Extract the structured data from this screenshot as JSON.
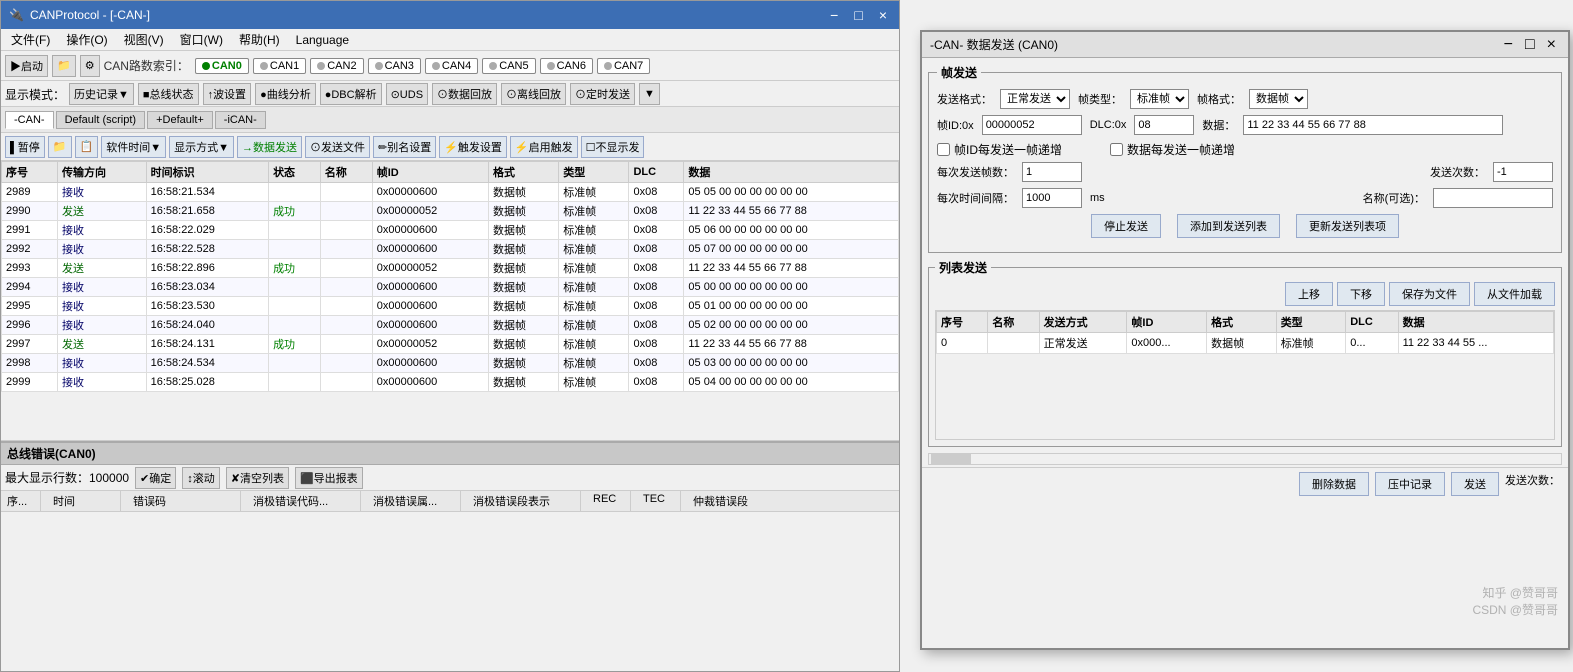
{
  "main_window": {
    "title": "CANProtocol - [-CAN-]",
    "title_btns": [
      "−",
      "□",
      "×"
    ]
  },
  "menu": {
    "items": [
      "文件(F)",
      "操作(O)",
      "视图(V)",
      "窗口(W)",
      "帮助(H)",
      "Language"
    ]
  },
  "toolbar1": {
    "can_path_label": "CAN路数索引：",
    "can_buttons": [
      {
        "label": "●CAN0",
        "active": true
      },
      {
        "label": "●CAN1",
        "active": false
      },
      {
        "label": "●CAN2",
        "active": false
      },
      {
        "label": "●CAN3",
        "active": false
      },
      {
        "label": "●CAN4",
        "active": false
      },
      {
        "label": "●CAN5",
        "active": false
      },
      {
        "label": "●CAN6",
        "active": false
      },
      {
        "label": "●CAN7",
        "active": false
      }
    ]
  },
  "toolbar2": {
    "buttons": [
      "显示模式：",
      "历史记录▼",
      "■总线状态",
      "↑波设置",
      "●曲线分析",
      "●DBC解析",
      "⊙UDS",
      "⊙数据回放",
      "⊙离线回放",
      "⊙定时发送",
      "▼"
    ]
  },
  "tabs": {
    "items": [
      "-CAN-",
      "Default (script)",
      "+Default+",
      "-iCAN-"
    ]
  },
  "toolbar3": {
    "buttons": [
      "▌暂停",
      "📁",
      "📋",
      "软件时间▼",
      "显示方式▼",
      "→数据发送",
      "⊙发送文件",
      "✏别名设置",
      "⚡触发设置",
      "⚡启用触发",
      "☐不显示发"
    ]
  },
  "table": {
    "headers": [
      "序号",
      "传输方向",
      "时间标识",
      "状态",
      "名称",
      "帧ID",
      "格式",
      "类型",
      "DLC",
      "数据"
    ],
    "rows": [
      {
        "id": "2989",
        "dir": "接收",
        "time": "16:58:21.534",
        "status": "",
        "name": "",
        "frame_id": "0x00000600",
        "format": "数据帧",
        "type": "标准帧",
        "dlc": "0x08",
        "data": "05 05 00 00 00 00 00 00"
      },
      {
        "id": "2990",
        "dir": "发送",
        "time": "16:58:21.658",
        "status": "成功",
        "name": "",
        "frame_id": "0x00000052",
        "format": "数据帧",
        "type": "标准帧",
        "dlc": "0x08",
        "data": "11 22 33 44 55 66 77 88"
      },
      {
        "id": "2991",
        "dir": "接收",
        "time": "16:58:22.029",
        "status": "",
        "name": "",
        "frame_id": "0x00000600",
        "format": "数据帧",
        "type": "标准帧",
        "dlc": "0x08",
        "data": "05 06 00 00 00 00 00 00"
      },
      {
        "id": "2992",
        "dir": "接收",
        "time": "16:58:22.528",
        "status": "",
        "name": "",
        "frame_id": "0x00000600",
        "format": "数据帧",
        "type": "标准帧",
        "dlc": "0x08",
        "data": "05 07 00 00 00 00 00 00"
      },
      {
        "id": "2993",
        "dir": "发送",
        "time": "16:58:22.896",
        "status": "成功",
        "name": "",
        "frame_id": "0x00000052",
        "format": "数据帧",
        "type": "标准帧",
        "dlc": "0x08",
        "data": "11 22 33 44 55 66 77 88"
      },
      {
        "id": "2994",
        "dir": "接收",
        "time": "16:58:23.034",
        "status": "",
        "name": "",
        "frame_id": "0x00000600",
        "format": "数据帧",
        "type": "标准帧",
        "dlc": "0x08",
        "data": "05 00 00 00 00 00 00 00"
      },
      {
        "id": "2995",
        "dir": "接收",
        "time": "16:58:23.530",
        "status": "",
        "name": "",
        "frame_id": "0x00000600",
        "format": "数据帧",
        "type": "标准帧",
        "dlc": "0x08",
        "data": "05 01 00 00 00 00 00 00"
      },
      {
        "id": "2996",
        "dir": "接收",
        "time": "16:58:24.040",
        "status": "",
        "name": "",
        "frame_id": "0x00000600",
        "format": "数据帧",
        "type": "标准帧",
        "dlc": "0x08",
        "data": "05 02 00 00 00 00 00 00"
      },
      {
        "id": "2997",
        "dir": "发送",
        "time": "16:58:24.131",
        "status": "成功",
        "name": "",
        "frame_id": "0x00000052",
        "format": "数据帧",
        "type": "标准帧",
        "dlc": "0x08",
        "data": "11 22 33 44 55 66 77 88"
      },
      {
        "id": "2998",
        "dir": "接收",
        "time": "16:58:24.534",
        "status": "",
        "name": "",
        "frame_id": "0x00000600",
        "format": "数据帧",
        "type": "标准帧",
        "dlc": "0x08",
        "data": "05 03 00 00 00 00 00 00"
      },
      {
        "id": "2999",
        "dir": "接收",
        "time": "16:58:25.028",
        "status": "",
        "name": "",
        "frame_id": "0x00000600",
        "format": "数据帧",
        "type": "标准帧",
        "dlc": "0x08",
        "data": "05 04 00 00 00 00 00 00"
      }
    ]
  },
  "error_section": {
    "title": "总线错误(CAN0)",
    "max_rows": "最大显示行数：100000",
    "confirm_btn": "✔确定",
    "scroll_btn": "↕滚动",
    "clear_btn": "✘清空列表",
    "export_btn": "⬛导出报表",
    "headers": [
      "序...",
      "时间",
      "错误码",
      "消极错误代码...",
      "消极错误属...",
      "消极错误段表示",
      "REC",
      "TEC",
      "仲裁错误段"
    ]
  },
  "dialog": {
    "title": "-CAN- 数据发送 (CAN0)",
    "close_btn": "×",
    "min_btn": "−",
    "restore_btn": "□",
    "frame_send_section": "帧发送",
    "send_format_label": "发送格式：",
    "send_format_value": "正常发送",
    "frame_type_label": "帧类型：",
    "frame_type_value": "标准帧",
    "frame_format_label": "帧格式：",
    "frame_format_value": "数据帧",
    "frame_id_label": "帧ID:0x",
    "frame_id_value": "00000052",
    "dlc_label": "DLC:0x",
    "dlc_value": "08",
    "data_label": "数据：",
    "data_value": "11 22 33 44 55 66 77 88",
    "check1": "帧ID每发送一帧递增",
    "check2": "数据每发送一帧递增",
    "send_count_label": "每次发送帧数：",
    "send_count_value": "1",
    "send_total_label": "发送次数：",
    "send_total_value": "-1",
    "interval_label": "每次时间间隔：",
    "interval_value": "1000",
    "interval_unit": "ms",
    "name_label": "名称(可选)：",
    "name_value": "",
    "stop_btn": "停止发送",
    "add_btn": "添加到发送列表",
    "update_btn": "更新发送列表项",
    "list_send_section": "列表发送",
    "up_btn": "上移",
    "down_btn": "下移",
    "save_btn": "保存为文件",
    "load_btn": "从文件加载",
    "list_headers": [
      "序号",
      "名称",
      "发送方式",
      "帧ID",
      "格式",
      "类型",
      "DLC",
      "数据"
    ],
    "list_rows": [
      {
        "id": "0",
        "name": "",
        "send_mode": "正常发送",
        "frame_id": "0x000...",
        "format": "数据帧",
        "type": "标准帧",
        "dlc": "0...",
        "data": "11 22 33 44 55 ..."
      }
    ],
    "bottom_btns": [
      "删除数据",
      "压中记录",
      "发送",
      "发送次数："
    ]
  },
  "watermark": {
    "line1": "知乎 @赞哥哥",
    "line2": "CSDN @赞哥哥"
  }
}
